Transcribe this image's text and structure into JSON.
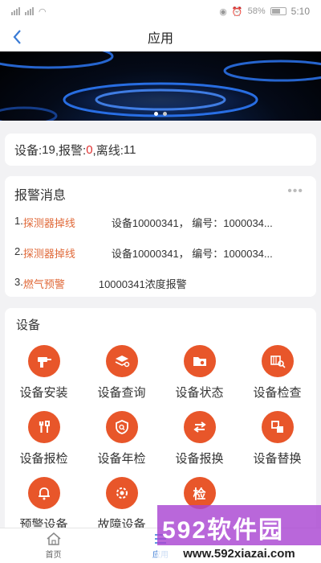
{
  "status_bar": {
    "battery": "58%",
    "time": "5:10"
  },
  "nav": {
    "back_icon": "chevron-left-icon",
    "title": "应用"
  },
  "banner": {
    "slide_count": 2,
    "active_slide": 1
  },
  "stats": {
    "device_label": "设备:",
    "device_count": "19",
    "alarm_label": ",报警:",
    "alarm_count": "0",
    "offline_label": ",离线:",
    "offline_count": "11",
    "alarm_color": "#e03131"
  },
  "alarms": {
    "title": "报警消息",
    "more": "•••",
    "items": [
      {
        "index": "1.",
        "type": "探测器掉线",
        "desc": "设备10000341， 编号：1000034..."
      },
      {
        "index": "2.",
        "type": "探测器掉线",
        "desc": "设备10000341， 编号：1000034..."
      },
      {
        "index": "3.",
        "type": "燃气预警",
        "desc": "10000341浓度报警"
      }
    ]
  },
  "devices": {
    "title": "设备",
    "accent": "#e8562a",
    "items": [
      {
        "label": "设备安装",
        "icon": "drill-icon"
      },
      {
        "label": "设备查询",
        "icon": "layers-search-icon"
      },
      {
        "label": "设备状态",
        "icon": "folder-status-icon"
      },
      {
        "label": "设备检查",
        "icon": "inspect-search-icon"
      },
      {
        "label": "设备报检",
        "icon": "wrench-icon"
      },
      {
        "label": "设备年检",
        "icon": "shield-search-icon"
      },
      {
        "label": "设备报换",
        "icon": "swap-icon"
      },
      {
        "label": "设备替换",
        "icon": "replace-icon"
      },
      {
        "label": "预警设备",
        "icon": "bell-icon"
      },
      {
        "label": "故障设备",
        "icon": "gear-broken-icon"
      },
      {
        "label": "",
        "icon": "inspect-badge-icon",
        "glyph": "检"
      }
    ]
  },
  "tabbar": {
    "items": [
      {
        "label": "首页",
        "icon": "home-icon"
      },
      {
        "label": "应用",
        "icon": "apps-icon"
      }
    ]
  },
  "watermark": {
    "main": "592软件园",
    "url": "www.592xiazai.com"
  }
}
